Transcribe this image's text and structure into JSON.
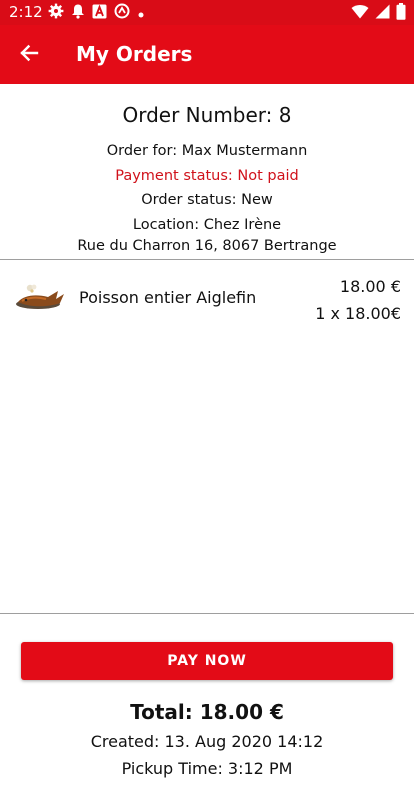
{
  "status_bar": {
    "time": "2:12"
  },
  "app_bar": {
    "title": "My Orders"
  },
  "order": {
    "number_label": "Order Number: 8",
    "order_for": "Order for: Max Mustermann",
    "payment_status": "Payment status: Not paid",
    "order_status": "Order status: New",
    "location_name": "Location: Chez Irène",
    "location_address": "Rue du Charron 16, 8067 Bertrange"
  },
  "items": [
    {
      "name": "Poisson entier Aiglefin",
      "price": "18.00 €",
      "quantity_line": "1 x 18.00€"
    }
  ],
  "actions": {
    "pay_now": "PAY NOW"
  },
  "summary": {
    "total": "Total: 18.00 €",
    "created": "Created: 13. Aug 2020 14:12",
    "pickup_time": "Pickup Time: 3:12 PM"
  },
  "colors": {
    "brand_red": "#e30b17",
    "status_bar_red": "#d90c17",
    "payment_text": "#d0121b"
  }
}
